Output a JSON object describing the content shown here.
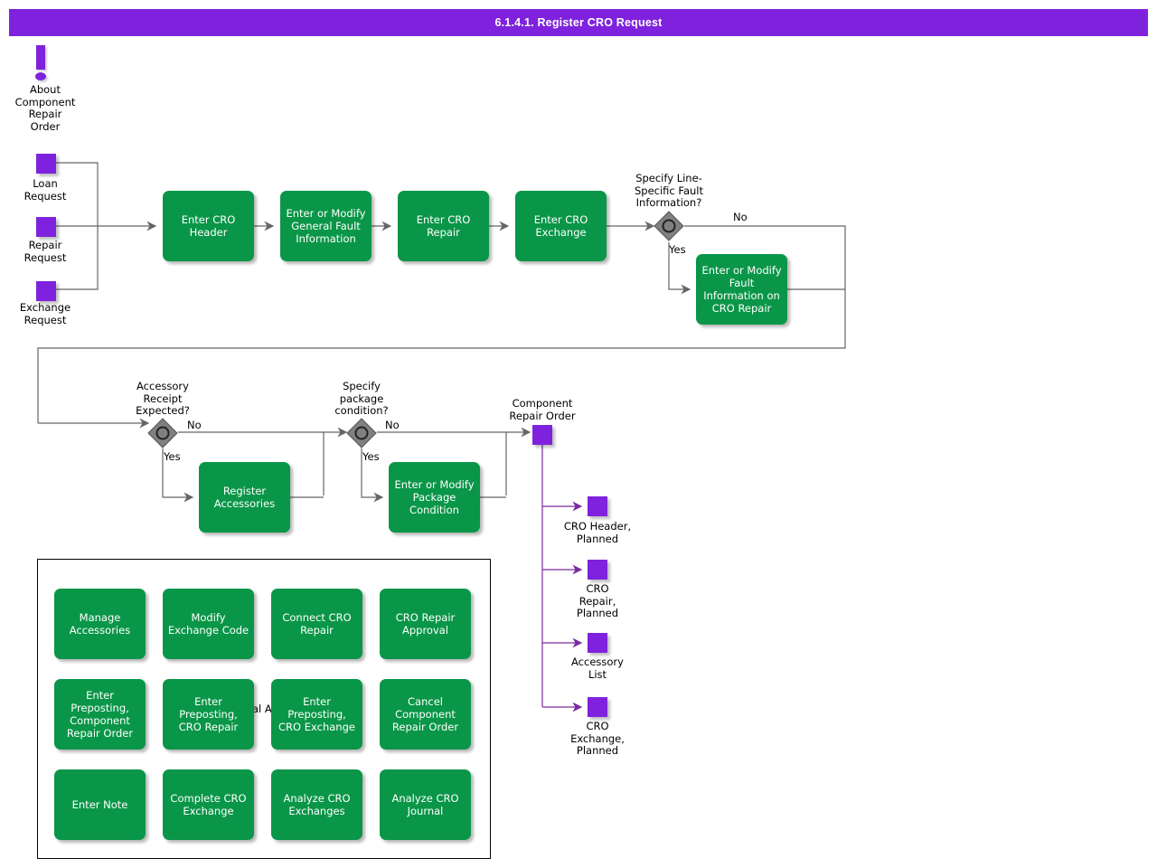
{
  "header": {
    "title": "6.1.4.1. Register CRO Request",
    "bg": "#7f22dd",
    "fg": "#ffffff"
  },
  "colors": {
    "activity": "#0a9648",
    "node": "#7f22dd",
    "decision": "#808080",
    "connector": "#666666",
    "node_connector": "#7a2aa0"
  },
  "info": {
    "icon": "exclamation-icon",
    "label": "About\nComponent\nRepair\nOrder"
  },
  "start_nodes": [
    {
      "label": "Loan\nRequest"
    },
    {
      "label": "Repair\nRequest"
    },
    {
      "label": "Exchange\nRequest"
    }
  ],
  "main_flow": [
    {
      "label": "Enter CRO\nHeader"
    },
    {
      "label": "Enter or Modify\nGeneral Fault\nInformation"
    },
    {
      "label": "Enter CRO\nRepair"
    },
    {
      "label": "Enter CRO\nExchange"
    }
  ],
  "decisions": [
    {
      "question": "Specify Line-\nSpecific Fault\nInformation?",
      "yes": "Yes",
      "no": "No",
      "yes_activity": "Enter or Modify\nFault Information\non CRO Repair"
    },
    {
      "question": "Accessory\nReceipt\nExpected?",
      "yes": "Yes",
      "no": "No",
      "yes_activity": "Register\nAccessories"
    },
    {
      "question": "Specify\npackage\ncondition?",
      "yes": "Yes",
      "no": "No",
      "yes_activity": "Enter or Modify\nPackage\nCondition"
    }
  ],
  "result_node": {
    "label": "Component\nRepair Order"
  },
  "outputs": [
    {
      "label": "CRO Header,\nPlanned"
    },
    {
      "label": "CRO\nRepair,\nPlanned"
    },
    {
      "label": "Accessory\nList"
    },
    {
      "label": "CRO\nExchange,\nPlanned"
    }
  ],
  "panel": {
    "occluded_label": "al Ac",
    "activities": [
      {
        "label": "Manage\nAccessories"
      },
      {
        "label": "Modify Exchange\nCode"
      },
      {
        "label": "Connect CRO\nRepair"
      },
      {
        "label": "CRO Repair\nApproval"
      },
      {
        "label": "Enter\nPreposting,\nComponent\nRepair Order"
      },
      {
        "label": "Enter\nPreposting,\nCRO Repair"
      },
      {
        "label": "Enter\nPreposting, CRO\nExchange"
      },
      {
        "label": "Cancel\nComponent\nRepair Order"
      },
      {
        "label": "Enter Note"
      },
      {
        "label": "Complete CRO\nExchange"
      },
      {
        "label": "Analyze CRO\nExchanges"
      },
      {
        "label": "Analyze CRO\nJournal"
      }
    ]
  }
}
